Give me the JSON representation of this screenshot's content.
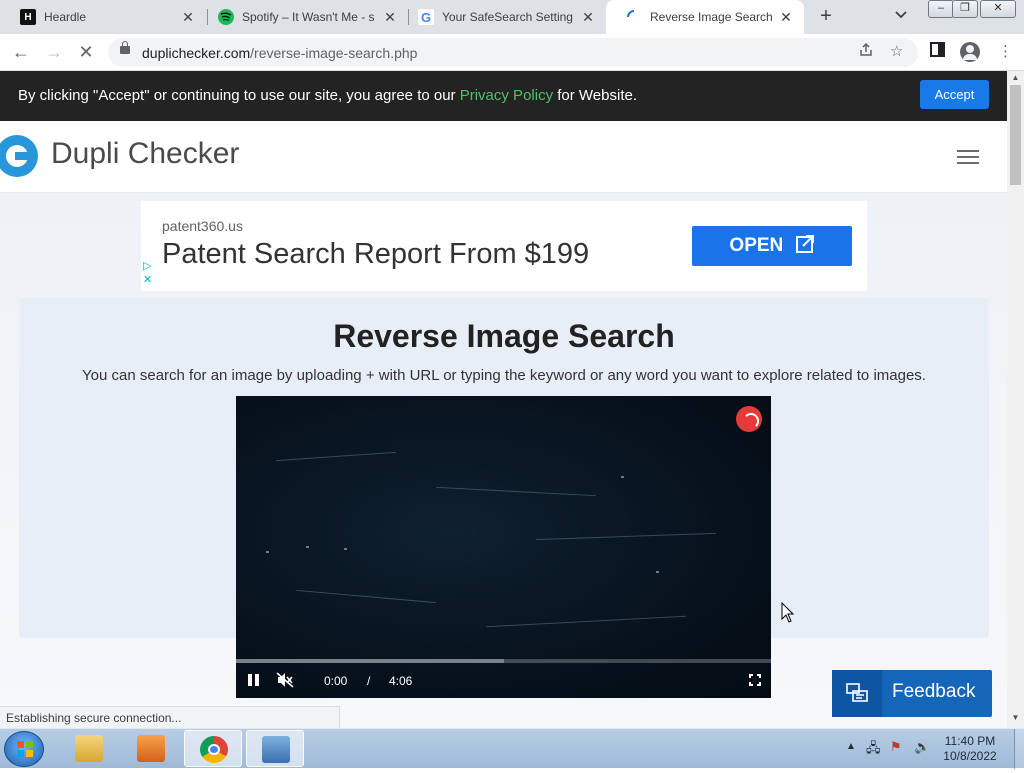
{
  "browser": {
    "tabs": [
      {
        "title": "Heardle",
        "favicon": "H",
        "fav_color": "#111111",
        "fav_text": "#ffffff"
      },
      {
        "title": "Spotify – It Wasn't Me - s",
        "favicon": "spotify",
        "fav_color": "#1db954",
        "fav_text": "#ffffff"
      },
      {
        "title": "Your SafeSearch Setting",
        "favicon": "G",
        "fav_color": "#ffffff",
        "fav_text": "#4285f4"
      },
      {
        "title": "Reverse Image Search - F",
        "favicon": "loading",
        "fav_color": "#ffffff",
        "fav_text": "#1a73e8"
      }
    ],
    "new_tab": "+",
    "close_glyph": "✕",
    "url_host": "duplichecker.com",
    "url_path": "/reverse-image-search.php",
    "window_buttons": [
      "–",
      "❐",
      "✕"
    ]
  },
  "cookie_banner": {
    "text_before": "By clicking \"Accept\" or continuing to use our site, you agree to our ",
    "link": "Privacy Policy",
    "text_after": " for Website.",
    "accept_label": "Accept"
  },
  "site": {
    "logo_text": "Dupli Checker",
    "accent": "#2896d8"
  },
  "ad": {
    "domain": "patent360.us",
    "headline": "Patent Search Report From $199",
    "cta": "OPEN"
  },
  "main": {
    "title": "Reverse Image Search",
    "description": "You can search for an image by uploading + with URL or typing the keyword or any word you want to explore related to images."
  },
  "video": {
    "current_time": "0:00",
    "separator": "/",
    "duration": "4:06",
    "buffered_fraction": 0.5
  },
  "feedback": {
    "label": "Feedback"
  },
  "status_bar": {
    "text": "Establishing secure connection..."
  },
  "taskbar": {
    "time": "11:40 PM",
    "date": "10/8/2022"
  }
}
